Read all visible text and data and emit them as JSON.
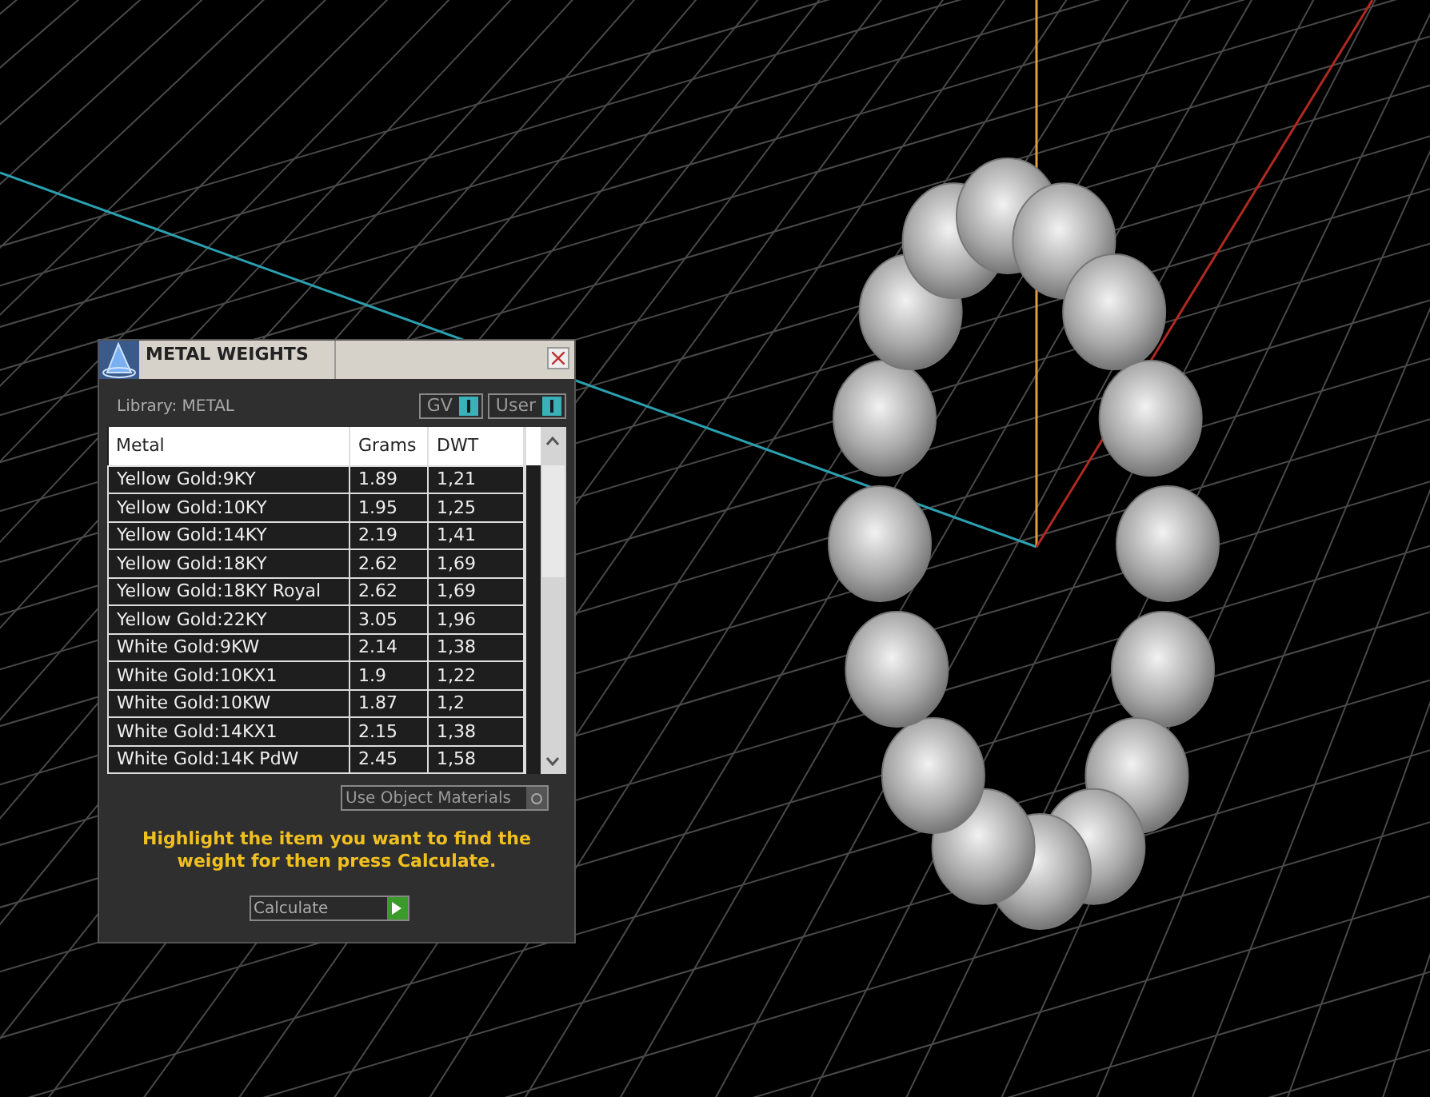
{
  "dialog": {
    "title": "METAL WEIGHTS",
    "library_label": "Library: METAL",
    "toggles": [
      {
        "label": "GV",
        "on": true
      },
      {
        "label": "User",
        "on": true
      }
    ],
    "table": {
      "columns": [
        "Metal",
        "Grams",
        "DWT"
      ],
      "rows": [
        {
          "metal": "Yellow Gold:9KY",
          "grams": "1.89",
          "dwt": "1,21"
        },
        {
          "metal": "Yellow Gold:10KY",
          "grams": "1.95",
          "dwt": "1,25"
        },
        {
          "metal": "Yellow Gold:14KY",
          "grams": "2.19",
          "dwt": "1,41"
        },
        {
          "metal": "Yellow Gold:18KY",
          "grams": "2.62",
          "dwt": "1,69"
        },
        {
          "metal": "Yellow Gold:18KY Royal",
          "grams": "2.62",
          "dwt": "1,69"
        },
        {
          "metal": "Yellow Gold:22KY",
          "grams": "3.05",
          "dwt": "1,96"
        },
        {
          "metal": "White Gold:9KW",
          "grams": "2.14",
          "dwt": "1,38"
        },
        {
          "metal": "White Gold:10KX1",
          "grams": "1.9",
          "dwt": "1,22"
        },
        {
          "metal": "White Gold:10KW",
          "grams": "1.87",
          "dwt": "1,2"
        },
        {
          "metal": "White Gold:14KX1",
          "grams": "2.15",
          "dwt": "1,38"
        },
        {
          "metal": "White Gold:14K PdW",
          "grams": "2.45",
          "dwt": "1,58"
        }
      ]
    },
    "object_materials": {
      "label": "Use Object Materials",
      "on": false
    },
    "hint": "Highlight the item you want to find the weight for then press Calculate.",
    "calculate_button": "Calculate"
  }
}
